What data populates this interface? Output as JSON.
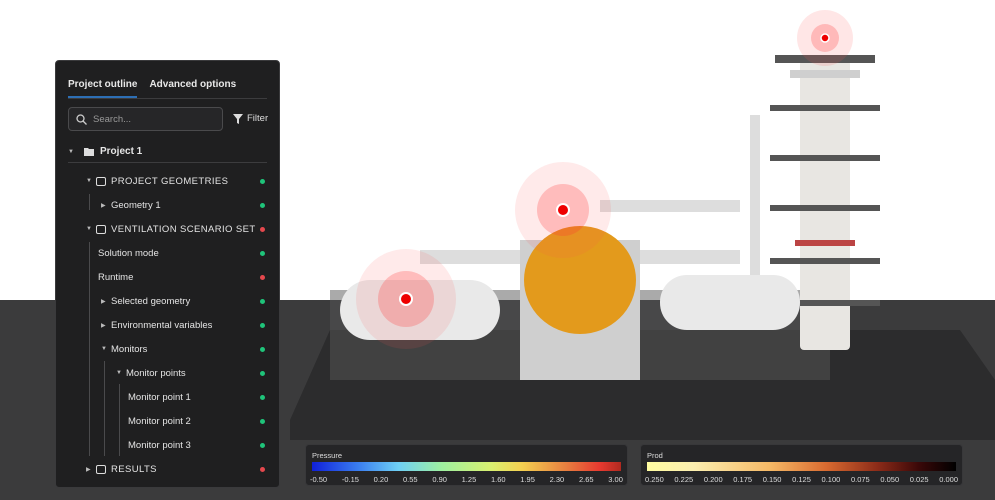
{
  "panel": {
    "tabs": [
      "Project outline",
      "Advanced options"
    ],
    "search_placeholder": "Search...",
    "filter_label": "Filter",
    "project": "Project 1",
    "items": [
      {
        "label": "PROJECT GEOMETRIES",
        "status": "ok"
      },
      {
        "label": "Geometry 1",
        "status": "ok"
      },
      {
        "label": "VENTILATION SCENARIO SET",
        "status": "error"
      },
      {
        "label": "Solution mode",
        "status": "ok"
      },
      {
        "label": "Runtime",
        "status": "error"
      },
      {
        "label": "Selected geometry",
        "status": "ok"
      },
      {
        "label": "Environmental variables",
        "status": "ok"
      },
      {
        "label": "Monitors",
        "status": "ok"
      },
      {
        "label": "Monitor points",
        "status": "ok"
      },
      {
        "label": "Monitor point 1",
        "status": "ok"
      },
      {
        "label": "Monitor point 2",
        "status": "ok"
      },
      {
        "label": "Monitor point 3",
        "status": "ok"
      },
      {
        "label": "RESULTS",
        "status": "error"
      }
    ]
  },
  "colors": {
    "ok": "#1fc47a",
    "error": "#e5484d",
    "accent": "#2d6fb5"
  },
  "legends": [
    {
      "title": "Pressure",
      "ticks": [
        "-0.50",
        "-0.15",
        "0.20",
        "0.55",
        "0.90",
        "1.25",
        "1.60",
        "1.95",
        "2.30",
        "2.65",
        "3.00"
      ]
    },
    {
      "title": "Prod",
      "ticks": [
        "0.250",
        "0.225",
        "0.200",
        "0.175",
        "0.150",
        "0.125",
        "0.100",
        "0.075",
        "0.050",
        "0.025",
        "0.000"
      ]
    }
  ]
}
